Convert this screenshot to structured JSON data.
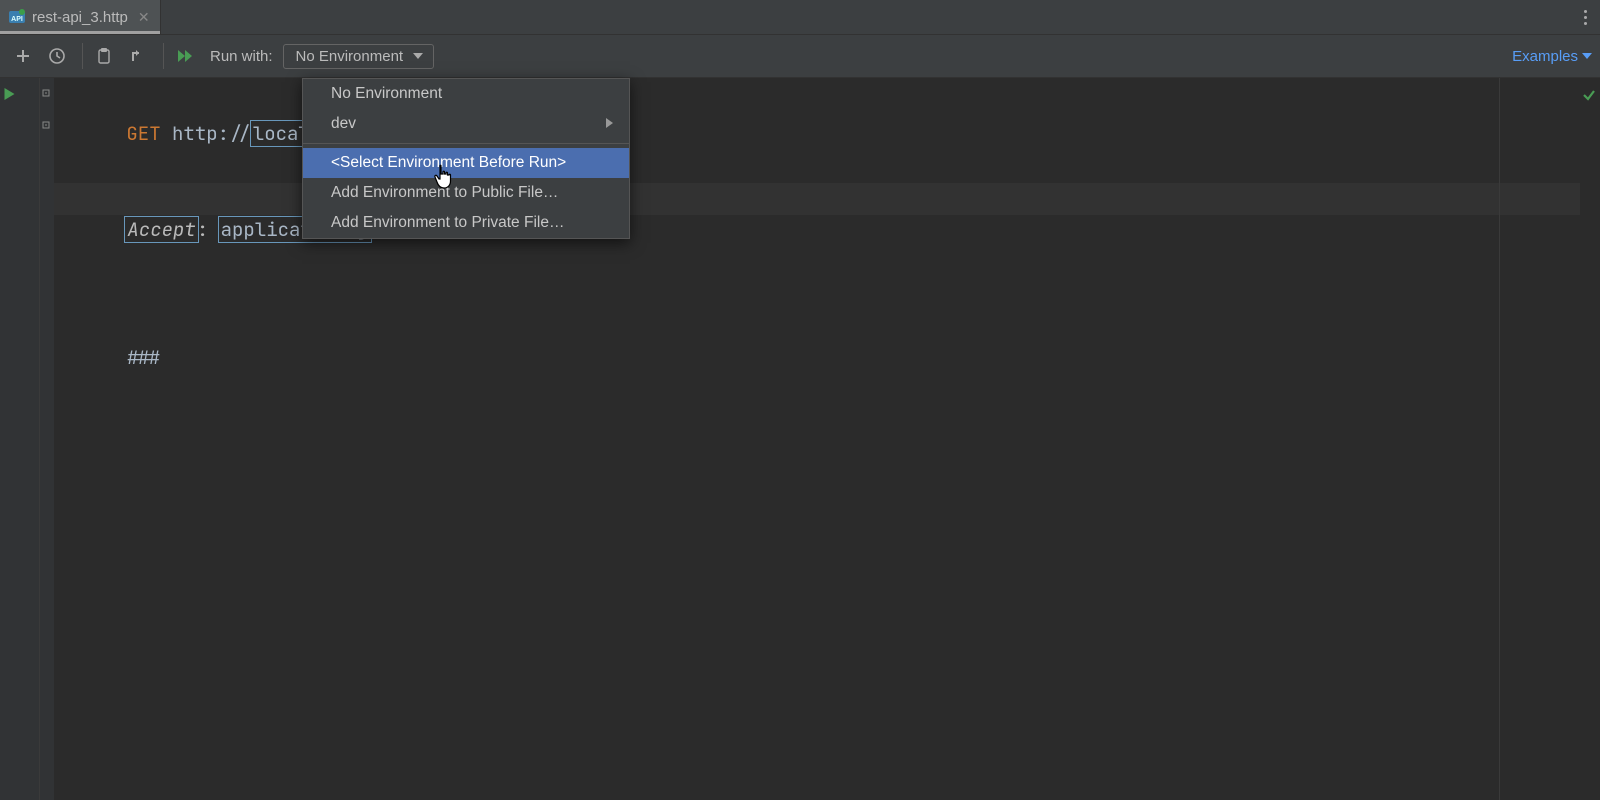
{
  "tab": {
    "filename": "rest-api_3.http"
  },
  "toolbar": {
    "run_with_label": "Run with:",
    "env_selected": "No Environment",
    "examples_label": "Examples"
  },
  "dropdown": {
    "items": [
      {
        "label": "No Environment",
        "submenu": false,
        "selected": false
      },
      {
        "label": "dev",
        "submenu": true,
        "selected": false
      }
    ],
    "separator_after": 1,
    "items2": [
      {
        "label": "<Select Environment Before Run>",
        "selected": true
      },
      {
        "label": "Add Environment to Public File…",
        "selected": false
      },
      {
        "label": "Add Environment to Private File…",
        "selected": false
      }
    ]
  },
  "code": {
    "line1_method": "GET",
    "line1_url_prefix": "http://",
    "line1_url_host": "localhost:",
    "line2_header": "Accept",
    "line2_colon": ": ",
    "line2_value": "application/j",
    "line4": "###"
  }
}
